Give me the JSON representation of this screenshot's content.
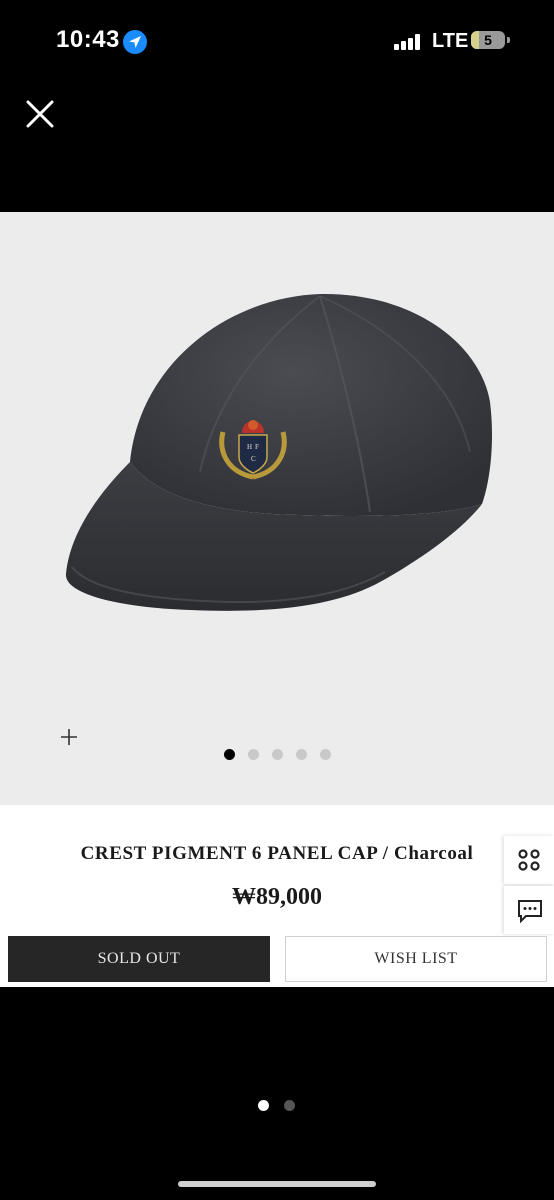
{
  "status_bar": {
    "time": "10:43",
    "carrier": "LTE",
    "battery": "5",
    "icons": [
      "location-arrow-icon",
      "signal-bars-icon",
      "battery-icon"
    ]
  },
  "nav": {
    "close_icon": "close-icon"
  },
  "gallery": {
    "image_alt": "charcoal cap with crest emblem",
    "zoom_icon": "plus-icon",
    "page_count": 5,
    "active_index": 0
  },
  "product": {
    "title": "CREST PIGMENT 6 PANEL CAP / Charcoal",
    "price": "₩89,000"
  },
  "side_actions": [
    {
      "icon": "grid-icon"
    },
    {
      "icon": "chat-icon"
    }
  ],
  "actions": {
    "sold_out_label": "SOLD OUT",
    "wish_list_label": "WISH LIST"
  },
  "viewer": {
    "page_count": 2,
    "active_index": 0
  },
  "colors": {
    "accent_location": "#1a8cff",
    "sold_out_bg": "#262626",
    "gallery_bg": "#ececec",
    "cap": "#3b3d42"
  }
}
